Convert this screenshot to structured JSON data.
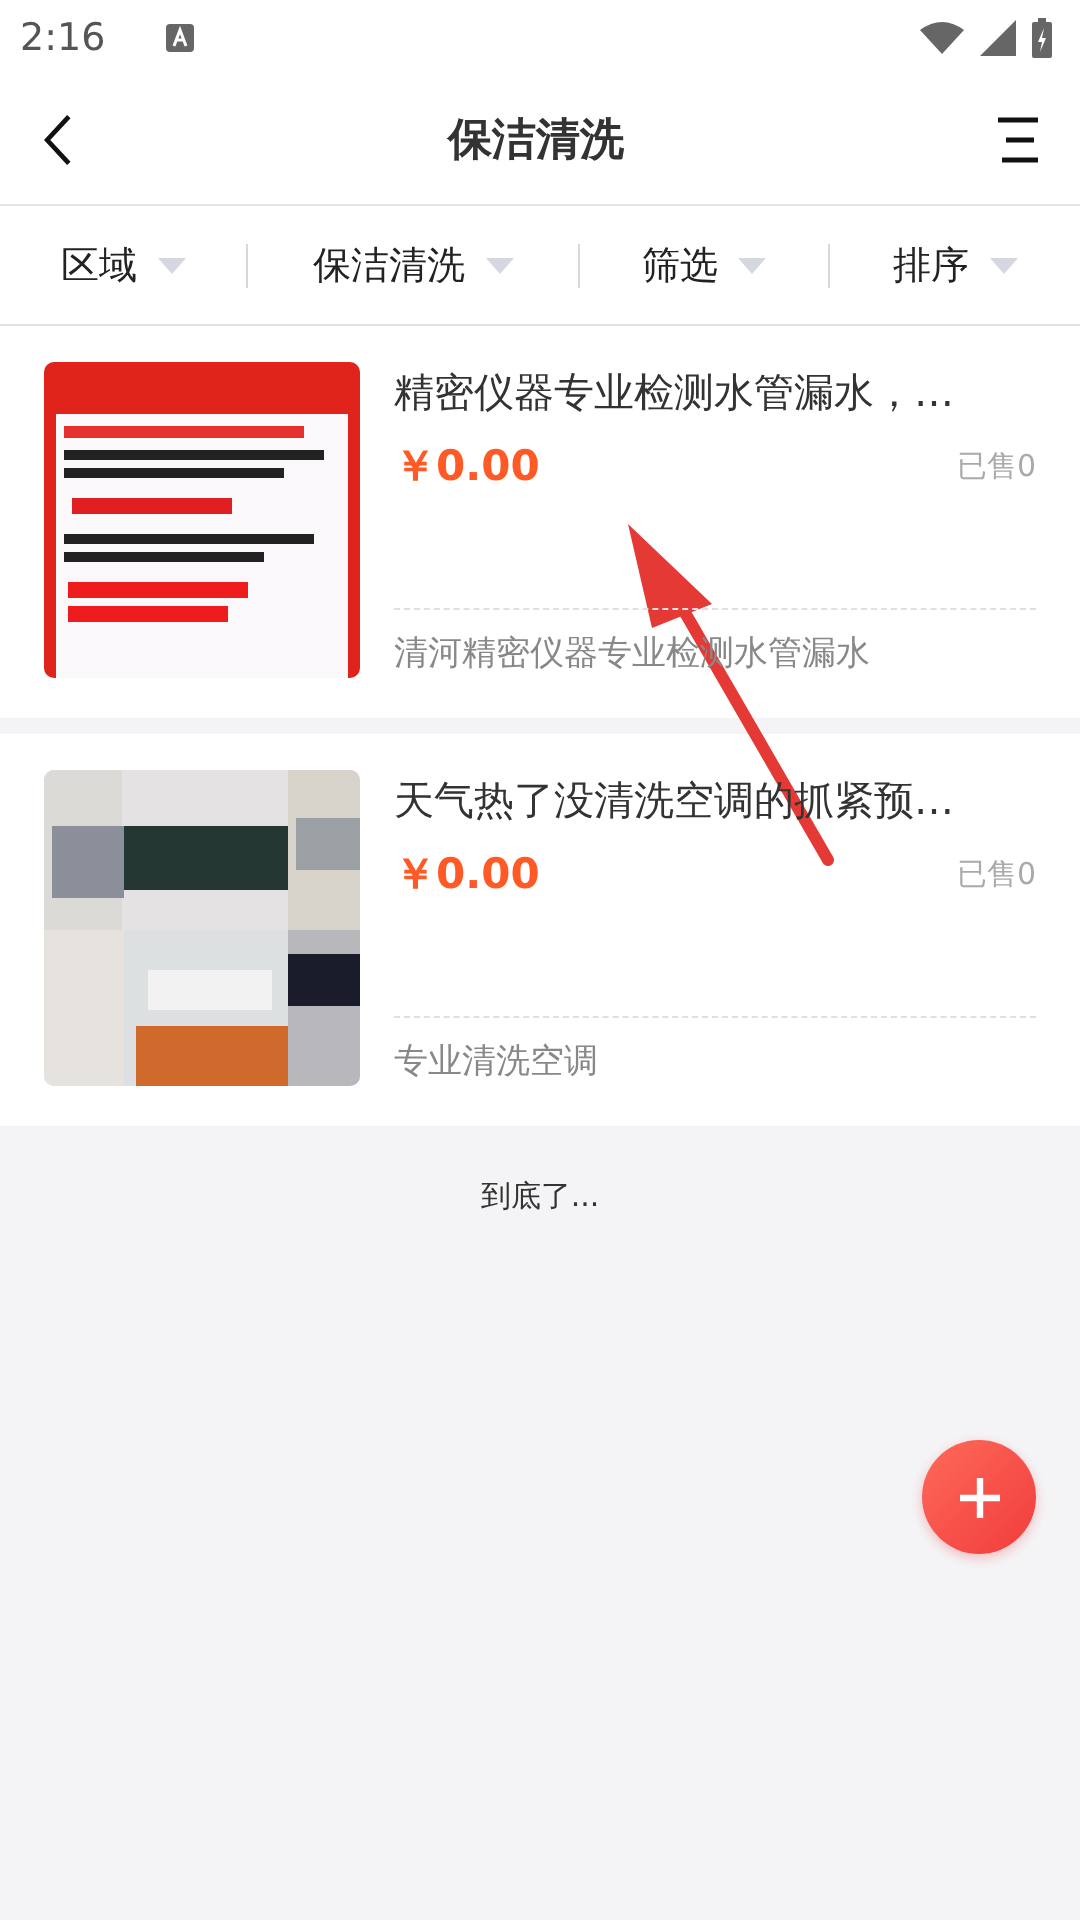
{
  "status_bar": {
    "time": "2:16"
  },
  "header": {
    "title": "保洁清洗"
  },
  "filters": [
    {
      "label": "区域"
    },
    {
      "label": "保洁清洗"
    },
    {
      "label": "筛选"
    },
    {
      "label": "排序"
    }
  ],
  "listings": [
    {
      "title": "精密仪器专业检测水管漏水，…",
      "price": "￥0.00",
      "sold": "已售0",
      "subtitle": "清河精密仪器专业检测水管漏水"
    },
    {
      "title": "天气热了没清洗空调的抓紧预…",
      "price": "￥0.00",
      "sold": "已售0",
      "subtitle": "专业清洗空调"
    }
  ],
  "footer_text": "到底了..."
}
